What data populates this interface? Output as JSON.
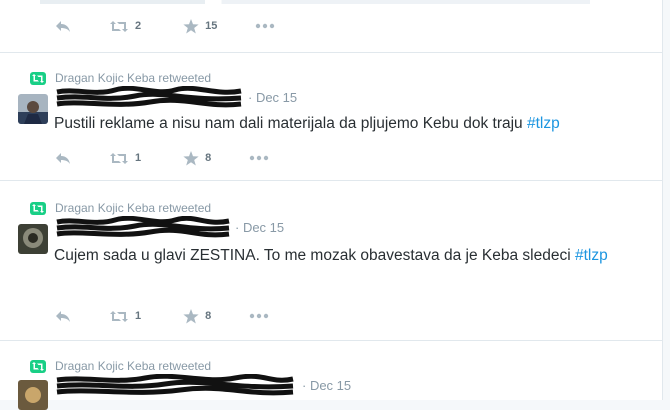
{
  "tweets": [
    {
      "retweeted_by": "",
      "date": "",
      "text": "",
      "hashtag": "",
      "retweet_count": "2",
      "favorite_count": "15"
    },
    {
      "retweeted_by": "Dragan Kojic Keba retweeted",
      "date": "· Dec 15",
      "text": "Pustili reklame a nisu nam dali materijala da pljujemo Kebu dok traju ",
      "hashtag": "#tlzp",
      "retweet_count": "1",
      "favorite_count": "8"
    },
    {
      "retweeted_by": "Dragan Kojic Keba retweeted",
      "date": "· Dec 15",
      "text": "Cujem sada u glavi ZESTINA. To me mozak obavestava da je Keba sledeci ",
      "hashtag": "#tlzp",
      "retweet_count": "1",
      "favorite_count": "8"
    },
    {
      "retweeted_by": "Dragan Kojic Keba retweeted",
      "date": "· Dec 15",
      "text": "",
      "hashtag": "",
      "retweet_count": "",
      "favorite_count": ""
    }
  ],
  "icons": {
    "retweet": "retweet-icon",
    "reply": "reply-icon",
    "favorite": "star-icon",
    "more": "more-icon"
  },
  "colors": {
    "retweet_green": "#19cf86",
    "hashtag_blue": "#1b95e0",
    "meta_gray": "#8899a6",
    "text_dark": "#292f33"
  }
}
